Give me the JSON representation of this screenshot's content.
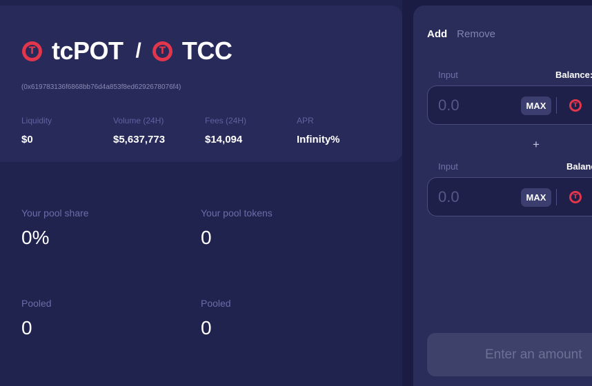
{
  "pair": {
    "token_a": "tcPOT",
    "separator": "/",
    "token_b": "TCC",
    "address": "(0x619783136f6868bb76d4a853f8ed6292678076f4)"
  },
  "stats": [
    {
      "label": "Liquidity",
      "value": "$0"
    },
    {
      "label": "Volume (24H)",
      "value": "$5,637,773"
    },
    {
      "label": "Fees (24H)",
      "value": "$14,094"
    },
    {
      "label": "APR",
      "value": "Infinity%"
    }
  ],
  "pool": {
    "share_label": "Your pool share",
    "share_value": "0%",
    "tokens_label": "Your pool tokens",
    "tokens_value": "0",
    "pooled_a_label": "Pooled",
    "pooled_a_value": "0",
    "pooled_b_label": "Pooled",
    "pooled_b_value": "0"
  },
  "liquidity_form": {
    "tabs": [
      "Add",
      "Remove"
    ],
    "input_1": {
      "label": "Input",
      "balance_label": "Balance:",
      "placeholder": "0.0",
      "max_label": "MAX"
    },
    "plus": "+",
    "input_2": {
      "label": "Input",
      "balance_label": "Balance",
      "placeholder": "0.0",
      "max_label": "MAX"
    },
    "submit_label": "Enter an amount"
  },
  "colors": {
    "accent": "#e2364c",
    "background": "#1b1c44",
    "card": "#282a5a"
  },
  "icons": {
    "token_logo": "tcpot-token-icon"
  }
}
